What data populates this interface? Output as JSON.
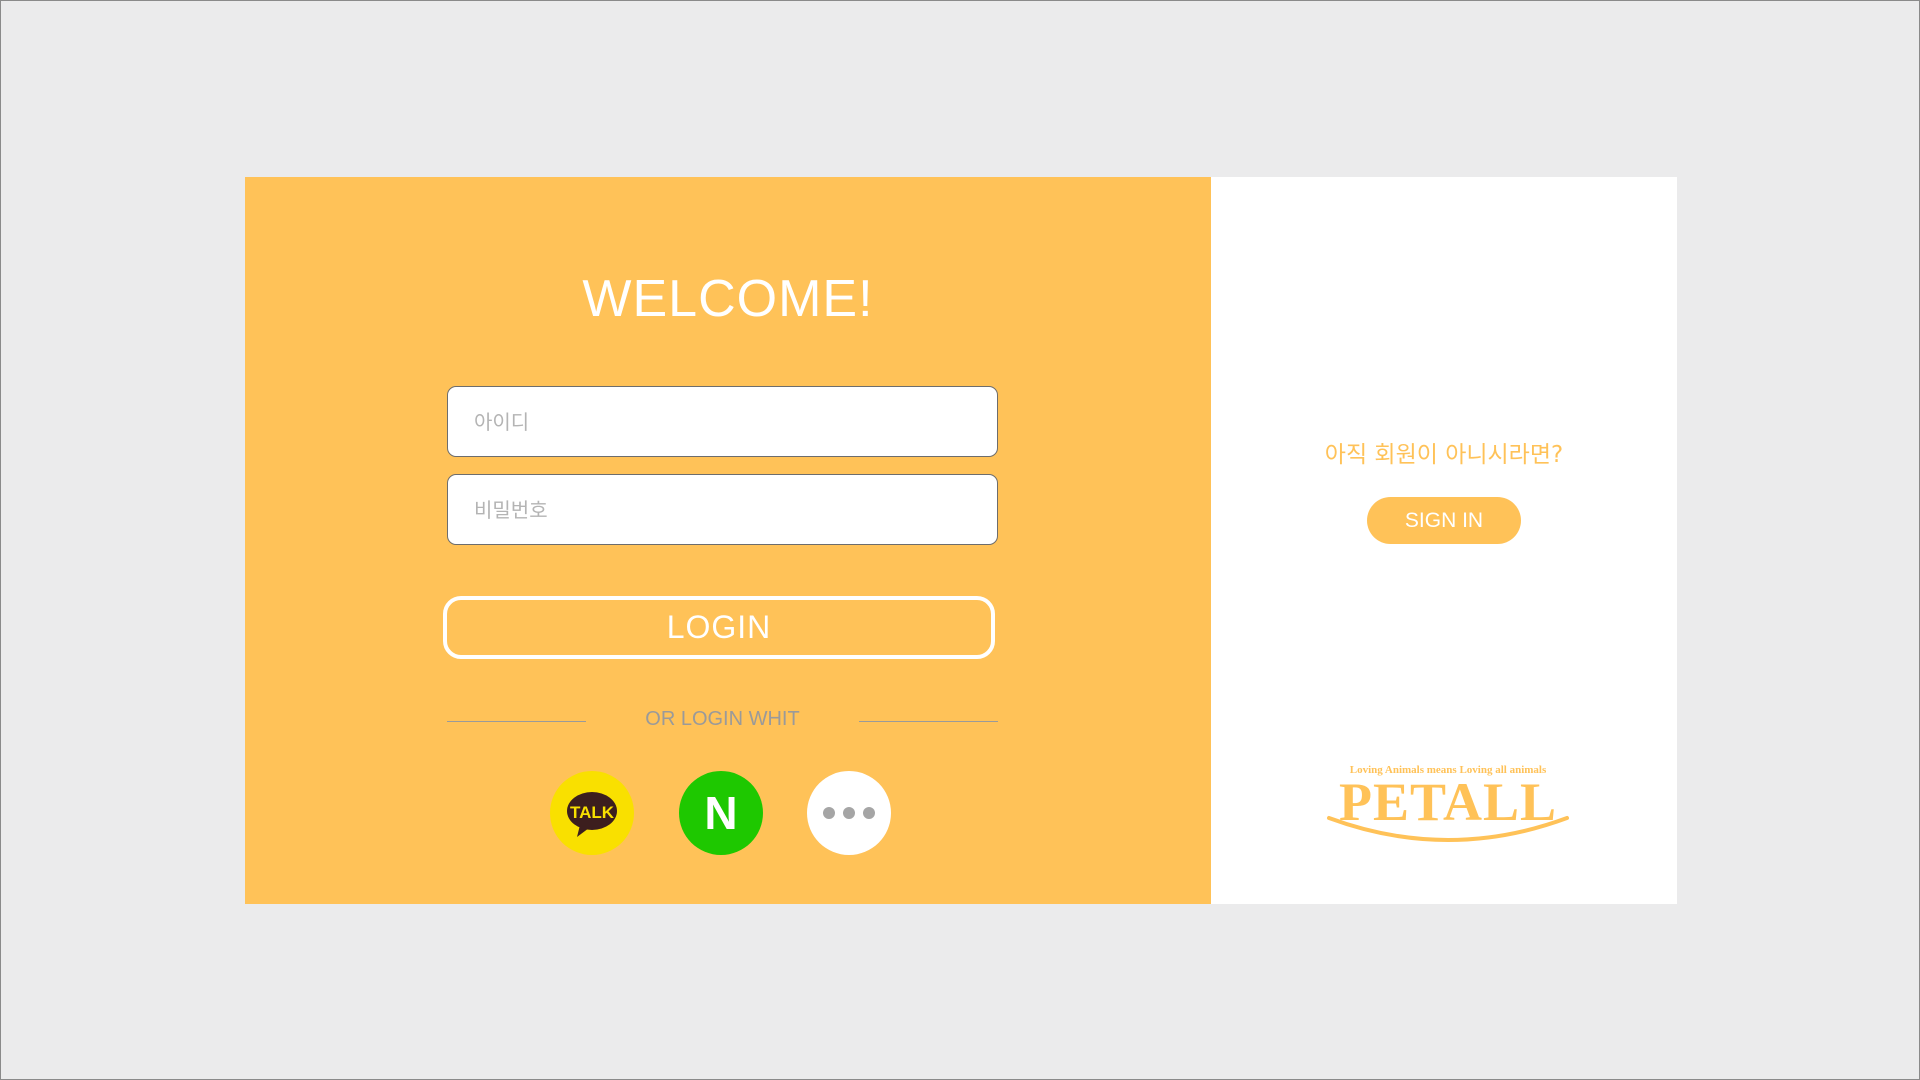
{
  "welcome": {
    "title": "WELCOME!"
  },
  "form": {
    "id_placeholder": "아이디",
    "password_placeholder": "비밀번호",
    "login_label": "LOGIN"
  },
  "social": {
    "divider_text": "OR LOGIN WHIT",
    "kakao_label": "TALK",
    "naver_label": "N",
    "more_icon": "more-dots-icon"
  },
  "signup": {
    "question": "아직 회원이 아니시라면?",
    "button_label": "SIGN IN"
  },
  "logo": {
    "tagline": "Loving Animals means Loving all animals",
    "name": "PETALL"
  },
  "colors": {
    "accent": "#ffc258",
    "background": "#ebebec",
    "kakao": "#f9e000",
    "naver": "#1ec800"
  }
}
